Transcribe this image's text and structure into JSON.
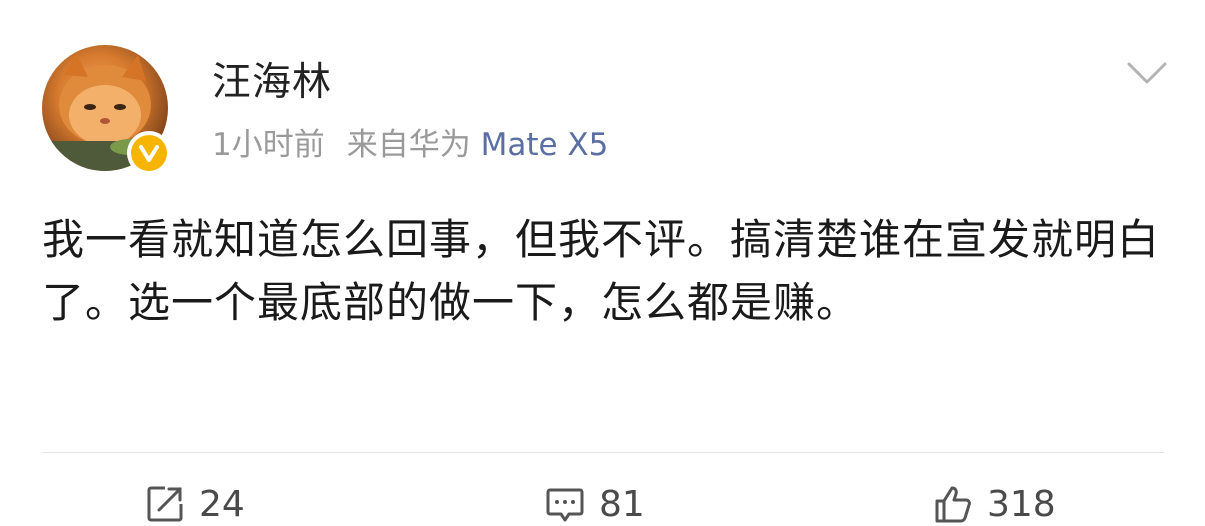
{
  "post": {
    "author": "汪海林",
    "time": "1小时前",
    "source_prefix": "来自华为",
    "source_device": "Mate X5",
    "content": "我一看就知道怎么回事，但我不评。搞清楚谁在宣发就明白了。选一个最底部的做一下，怎么都是赚。"
  },
  "actions": {
    "repost_count": "24",
    "comment_count": "81",
    "like_count": "318"
  },
  "icons": {
    "verified": "verified-badge-icon",
    "menu": "chevron-down-icon",
    "repost": "repost-icon",
    "comment": "comment-icon",
    "like": "thumbs-up-icon"
  },
  "colors": {
    "verified_badge": "#f7b500",
    "source_link": "#5b6fa3",
    "meta_gray": "#9a9a9a"
  }
}
